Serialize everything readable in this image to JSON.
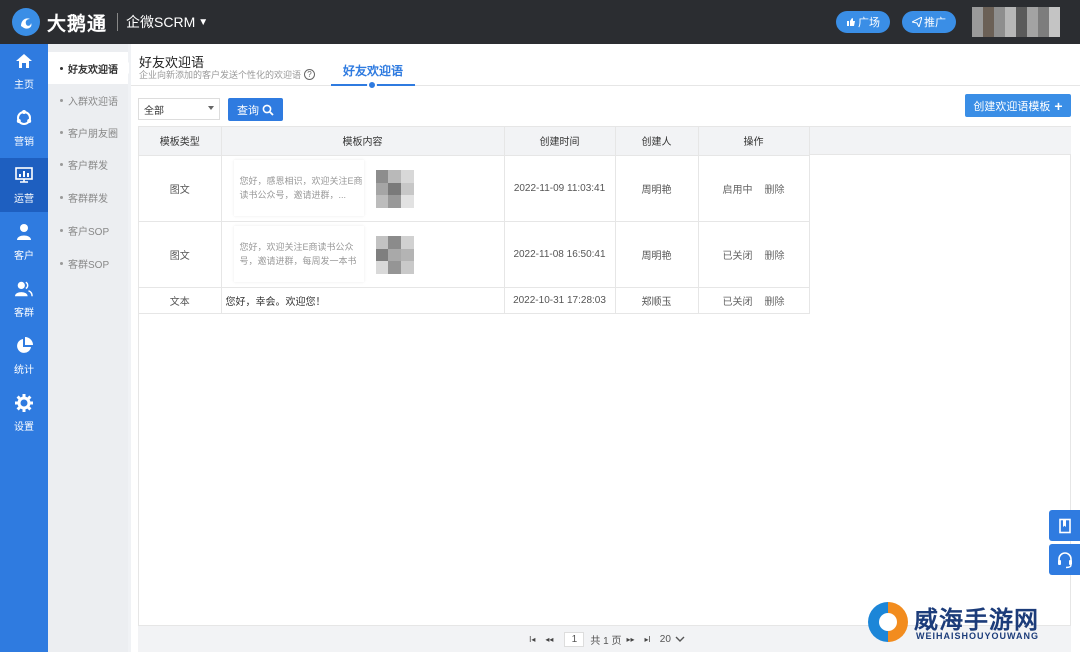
{
  "topbar": {
    "brand": "大鹅通",
    "product": "企微SCRM",
    "buttons": [
      {
        "label": "广场"
      },
      {
        "label": "推广"
      }
    ]
  },
  "leftnav": {
    "items": [
      {
        "label": "主页",
        "icon": "home-icon"
      },
      {
        "label": "营销",
        "icon": "marketing-icon"
      },
      {
        "label": "运营",
        "icon": "operation-icon",
        "active": true
      },
      {
        "label": "客户",
        "icon": "user-icon"
      },
      {
        "label": "客群",
        "icon": "group-icon"
      },
      {
        "label": "统计",
        "icon": "pie-chart-icon"
      },
      {
        "label": "设置",
        "icon": "gear-icon"
      }
    ]
  },
  "subnav": {
    "items": [
      {
        "label": "好友欢迎语",
        "active": true
      },
      {
        "label": "入群欢迎语"
      },
      {
        "label": "客户朋友圈"
      },
      {
        "label": "客户群发"
      },
      {
        "label": "客群群发"
      },
      {
        "label": "客户SOP"
      },
      {
        "label": "客群SOP"
      }
    ]
  },
  "main": {
    "title": "好友欢迎语",
    "description": "企业向新添加的客户发送个性化的欢迎语",
    "help_mark": "?",
    "tab": "好友欢迎语",
    "filter_value": "全部",
    "query_label": "查询",
    "create_label": "创建欢迎语模板",
    "create_plus": "+"
  },
  "table": {
    "columns": [
      "模板类型",
      "模板内容",
      "创建时间",
      "创建人",
      "操作"
    ],
    "rows": [
      {
        "type": "图文",
        "content": "您好，感恩相识，欢迎关注E商读书公众号，邀请进群，...",
        "has_card": true,
        "time": "2022-11-09 11:03:41",
        "creator": "周明艳",
        "status": "启用中",
        "delete": "删除"
      },
      {
        "type": "图文",
        "content": "您好，欢迎关注E商读书公众号，邀请进群，每周发一本书",
        "has_card": true,
        "time": "2022-11-08 16:50:41",
        "creator": "周明艳",
        "status": "已关闭",
        "delete": "删除"
      },
      {
        "type": "文本",
        "content": "您好，幸会。欢迎您！",
        "has_card": false,
        "time": "2022-10-31 17:28:03",
        "creator": "郑顺玉",
        "status": "已关闭",
        "delete": "删除"
      }
    ]
  },
  "pager": {
    "first": "I◂",
    "prev": "◂◂",
    "current_page": "1",
    "total_text": "共 1 页",
    "next": "▸▸",
    "last": "▸I",
    "page_size": "20"
  },
  "watermark": {
    "title": "威海手游网",
    "subtitle": "WEIHAISHOUYOUWANG"
  },
  "colors": {
    "primary": "#2f7be0",
    "topbar": "#2b2d31",
    "nav_active": "#1e5fc0"
  }
}
